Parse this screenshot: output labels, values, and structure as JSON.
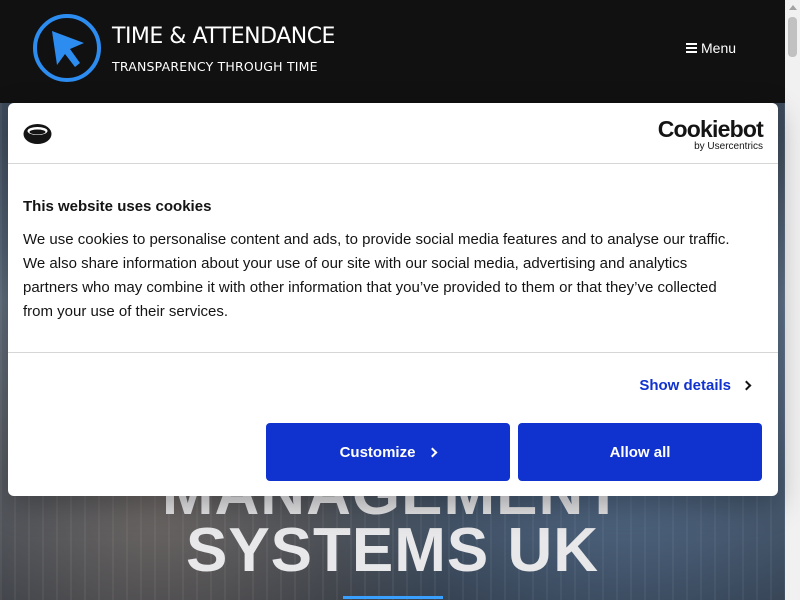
{
  "header": {
    "title": "TIME & ATTENDANCE",
    "tagline": "TRANSPARENCY THROUGH TIME",
    "menu_label": "Menu",
    "logo_icon": "cursor-circle-logo"
  },
  "hero": {
    "line1": "MANAGEMENT",
    "line2": "SYSTEMS UK"
  },
  "cookie_dialog": {
    "brand": "Cookiebot",
    "brand_by": "by Usercentrics",
    "heading": "This website uses cookies",
    "body": "We use cookies to personalise content and ads, to provide social media features and to analyse our traffic. We also share information about your use of our site with our social media, advertising and analytics partners who may combine it with other information that you’ve provided to them or that they’ve collected from your use of their services.",
    "show_details_label": "Show details",
    "customize_label": "Customize",
    "allow_all_label": "Allow all"
  },
  "colors": {
    "header_bg": "#111111",
    "accent_blue": "#1032cf",
    "logo_blue": "#2d8cf0"
  }
}
